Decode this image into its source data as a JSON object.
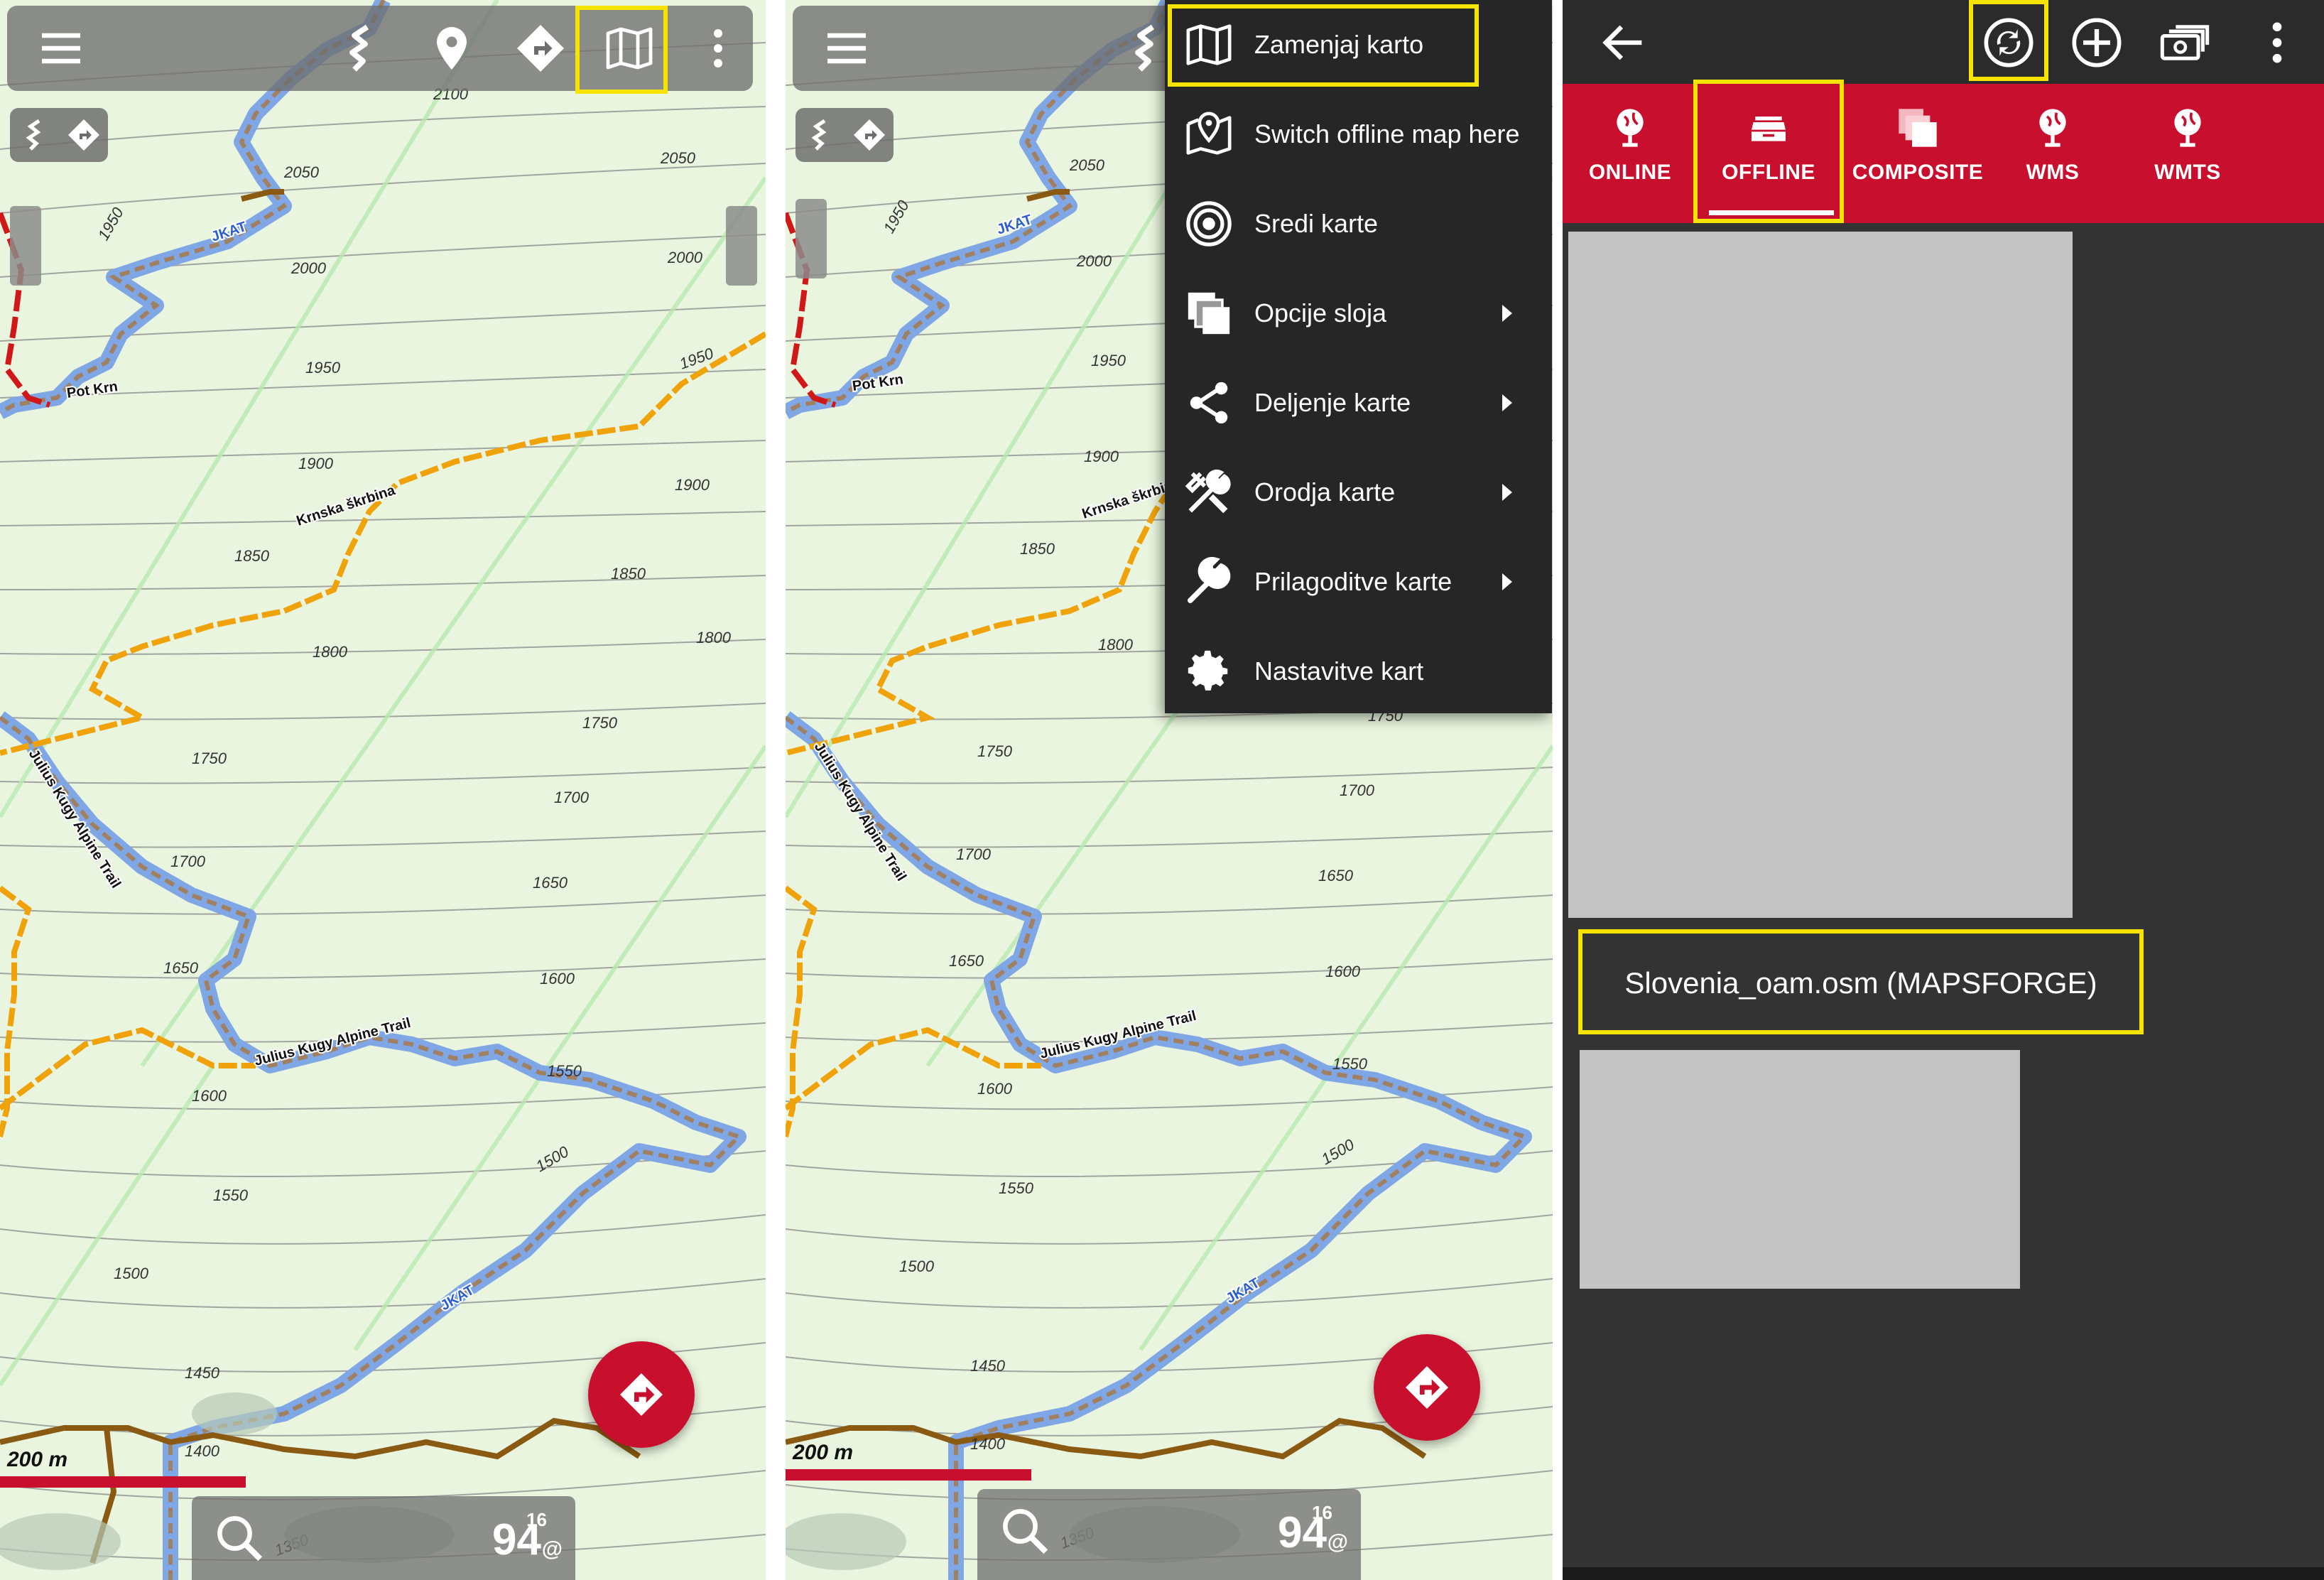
{
  "panels": {
    "left": {
      "scale_label": "200 m",
      "zoom_level": "94",
      "zoom_superscript": "16",
      "zoom_unit": "@",
      "trail_labels": {
        "jkat_top": "JKAT",
        "pot_krn": "Pot Krn",
        "krnska": "Krnska škrbina",
        "julius_upper": "Julius Kugy Alpine Trail",
        "julius_lower": "Julius Kugy Alpine Trail",
        "jkat_bottom": "JKAT"
      },
      "contours": [
        "2100",
        "2050",
        "2050",
        "2000",
        "2000",
        "1950",
        "1950",
        "1950",
        "1900",
        "1900",
        "1850",
        "1850",
        "1800",
        "1800",
        "1750",
        "1750",
        "1700",
        "1700",
        "1650",
        "1650",
        "1600",
        "1600",
        "1550",
        "1550",
        "1500",
        "1500",
        "1450",
        "1400",
        "1350"
      ]
    },
    "middle": {
      "scale_label": "200 m",
      "zoom_level": "94",
      "zoom_superscript": "16",
      "zoom_unit": "@",
      "trail_labels": {
        "jkat_top": "JKAT",
        "pot_krn": "Pot Krn",
        "krnska": "Krnska škrbin",
        "julius_upper": "Julius Kugy Alpine Trail",
        "julius_lower": "Julius Kugy Alpine Trail",
        "jkat_bottom": "JKAT"
      },
      "menu": {
        "items": [
          {
            "label": "Zamenjaj karto",
            "icon": "map-icon",
            "submenu": false
          },
          {
            "label": "Switch offline map here",
            "icon": "map-pin-icon",
            "submenu": false
          },
          {
            "label": "Sredi karte",
            "icon": "target-icon",
            "submenu": false
          },
          {
            "label": "Opcije sloja",
            "icon": "layers-icon",
            "submenu": true
          },
          {
            "label": "Deljenje karte",
            "icon": "share-icon",
            "submenu": true
          },
          {
            "label": "Orodja karte",
            "icon": "tools-icon",
            "submenu": true
          },
          {
            "label": "Prilagoditve karte",
            "icon": "wrench-icon",
            "submenu": true
          },
          {
            "label": "Nastavitve kart",
            "icon": "gear-icon",
            "submenu": false
          }
        ]
      }
    },
    "right": {
      "tabs": [
        {
          "label": "ONLINE",
          "icon": "globe-pin-icon"
        },
        {
          "label": "OFFLINE",
          "icon": "offline-tray-icon"
        },
        {
          "label": "COMPOSITE",
          "icon": "composite-icon"
        },
        {
          "label": "WMS",
          "icon": "globe-pin-icon"
        },
        {
          "label": "WMTS",
          "icon": "globe-pin-icon"
        }
      ],
      "active_tab": "OFFLINE",
      "map_entry": "Slovenia_oam.osm (MAPSFORGE)"
    }
  },
  "colors": {
    "map_bg": "#e9f5de",
    "accent_red": "#c8102e",
    "highlight": "#f5e400",
    "trail_blue": "#7fa7e6",
    "trail_orange": "#f0a20a",
    "contour": "#7a7a7a",
    "menu_bg": "#262626",
    "panel_dark": "#333333"
  }
}
